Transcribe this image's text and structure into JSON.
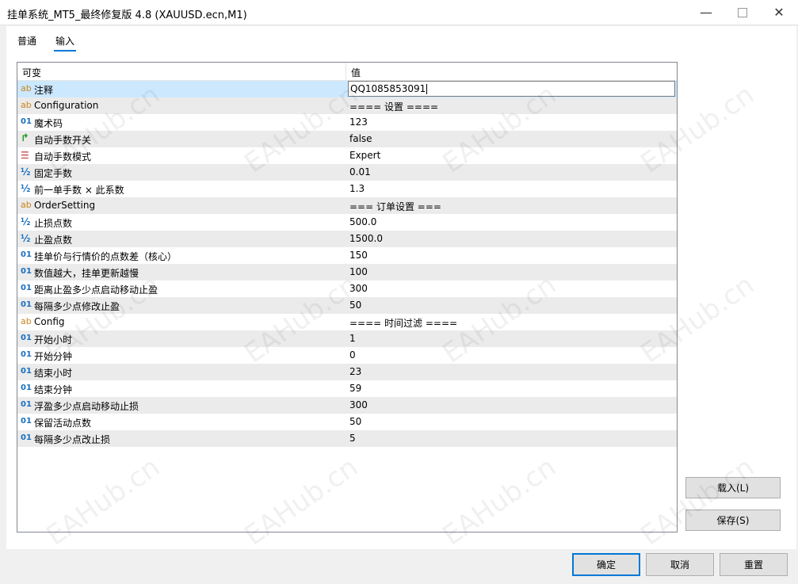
{
  "window": {
    "title": "挂单系统_MT5_最终修复版 4.8 (XAUUSD.ecn,M1)",
    "minimize": "—",
    "close": "✕"
  },
  "tabs": [
    {
      "label": "普通"
    },
    {
      "label": "输入",
      "active": true
    }
  ],
  "grid": {
    "col_variable": "可变",
    "col_value": "值",
    "rows": [
      {
        "icon": "ab",
        "name": "注释",
        "value": "QQ1085853091",
        "selected": true
      },
      {
        "icon": "ab",
        "name": "Configuration",
        "value": "==== 设置 ===="
      },
      {
        "icon": "01",
        "name": "魔术码",
        "value": "123"
      },
      {
        "icon": "arrow",
        "name": "自动手数开关",
        "value": "false"
      },
      {
        "icon": "list",
        "name": "自动手数模式",
        "value": "Expert"
      },
      {
        "icon": "½",
        "name": "固定手数",
        "value": "0.01"
      },
      {
        "icon": "½",
        "name": "前一单手数 × 此系数",
        "value": "1.3"
      },
      {
        "icon": "ab",
        "name": "OrderSetting",
        "value": "=== 订单设置 ==="
      },
      {
        "icon": "½",
        "name": "止损点数",
        "value": "500.0"
      },
      {
        "icon": "½",
        "name": "止盈点数",
        "value": "1500.0"
      },
      {
        "icon": "01",
        "name": "挂单价与行情价的点数差（核心）",
        "value": "150"
      },
      {
        "icon": "01",
        "name": "数值越大，挂单更新越慢",
        "value": "100"
      },
      {
        "icon": "01",
        "name": "距离止盈多少点启动移动止盈",
        "value": "300"
      },
      {
        "icon": "01",
        "name": "每隔多少点修改止盈",
        "value": "50"
      },
      {
        "icon": "ab",
        "name": "Config",
        "value": "==== 时间过滤 ===="
      },
      {
        "icon": "01",
        "name": "开始小时",
        "value": "1"
      },
      {
        "icon": "01",
        "name": "开始分钟",
        "value": "0"
      },
      {
        "icon": "01",
        "name": "结束小时",
        "value": "23"
      },
      {
        "icon": "01",
        "name": "结束分钟",
        "value": "59"
      },
      {
        "icon": "01",
        "name": "浮盈多少点启动移动止损",
        "value": "300"
      },
      {
        "icon": "01",
        "name": "保留活动点数",
        "value": "50"
      },
      {
        "icon": "01",
        "name": "每隔多少点改止损",
        "value": "5"
      }
    ]
  },
  "buttons": {
    "load": "载入(L)",
    "save": "保存(S)",
    "ok": "确定",
    "cancel": "取消",
    "reset": "重置"
  },
  "watermark": "EAHub.cn"
}
